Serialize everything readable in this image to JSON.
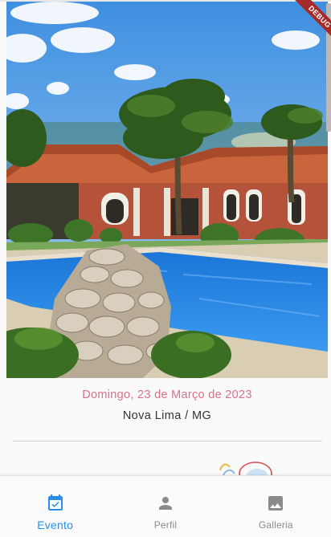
{
  "debug_banner": {
    "label": "DEBUG",
    "color": "#a62a2a"
  },
  "event": {
    "date": "Domingo, 23 de Março de 2023",
    "location": "Nova Lima / MG",
    "date_color": "#d8708a"
  },
  "hero_image": {
    "icon": "venue-photo-pool-house"
  },
  "bottom_nav": {
    "active_color": "#2a8ee8",
    "inactive_color": "#8a8a8a",
    "items": [
      {
        "label": "Evento",
        "icon": "event-available-icon",
        "active": true
      },
      {
        "label": "Perfil",
        "icon": "person-icon",
        "active": false
      },
      {
        "label": "Galleria",
        "icon": "image-icon",
        "active": false
      }
    ]
  }
}
